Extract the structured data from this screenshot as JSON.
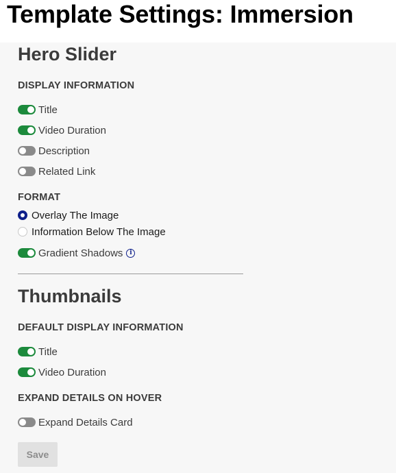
{
  "page": {
    "title": "Template Settings: Immersion"
  },
  "hero_slider": {
    "title": "Hero Slider",
    "display_information": {
      "heading": "DISPLAY INFORMATION",
      "items": [
        {
          "label": "Title",
          "state": "on"
        },
        {
          "label": "Video Duration",
          "state": "on"
        },
        {
          "label": "Description",
          "state": "off"
        },
        {
          "label": "Related Link",
          "state": "off"
        }
      ]
    },
    "format": {
      "heading": "FORMAT",
      "options": [
        {
          "label": "Overlay The Image",
          "selected": true
        },
        {
          "label": "Information Below The Image",
          "selected": false
        }
      ],
      "gradient_shadows": {
        "label": "Gradient Shadows",
        "state": "on",
        "info_icon": "i"
      }
    }
  },
  "thumbnails": {
    "title": "Thumbnails",
    "default_display_information": {
      "heading": "DEFAULT DISPLAY INFORMATION",
      "items": [
        {
          "label": "Title",
          "state": "on"
        },
        {
          "label": "Video Duration",
          "state": "on"
        }
      ]
    },
    "expand_details": {
      "heading": "EXPAND DETAILS ON HOVER",
      "item": {
        "label": "Expand Details Card",
        "state": "off"
      }
    }
  },
  "actions": {
    "save_label": "Save"
  },
  "colors": {
    "toggle_on": "#1c8a3c",
    "toggle_off": "#8a8a8a",
    "radio_selected": "#0e1f8a",
    "panel_background": "#f7f7f7"
  }
}
